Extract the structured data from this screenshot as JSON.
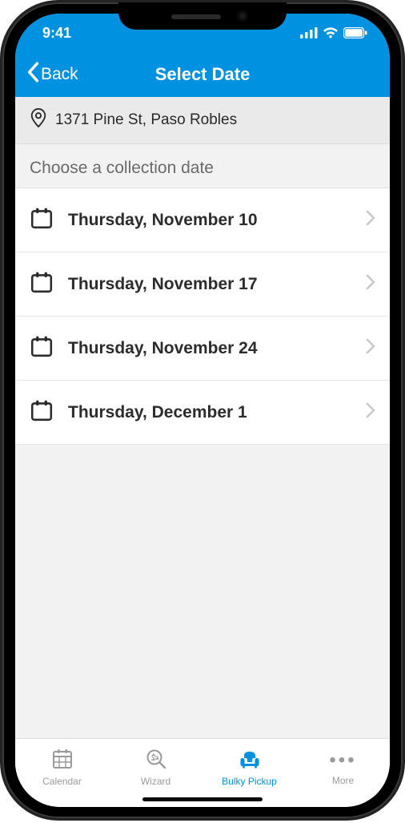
{
  "statusbar": {
    "time": "9:41"
  },
  "navbar": {
    "back_label": "Back",
    "title": "Select Date"
  },
  "address": {
    "text": "1371 Pine St, Paso Robles"
  },
  "section": {
    "header": "Choose a collection date"
  },
  "dates": [
    {
      "label": "Thursday, November 10"
    },
    {
      "label": "Thursday, November 17"
    },
    {
      "label": "Thursday, November 24"
    },
    {
      "label": "Thursday, December 1"
    }
  ],
  "tabs": {
    "calendar": "Calendar",
    "wizard": "Wizard",
    "bulky": "Bulky Pickup",
    "more": "More"
  }
}
